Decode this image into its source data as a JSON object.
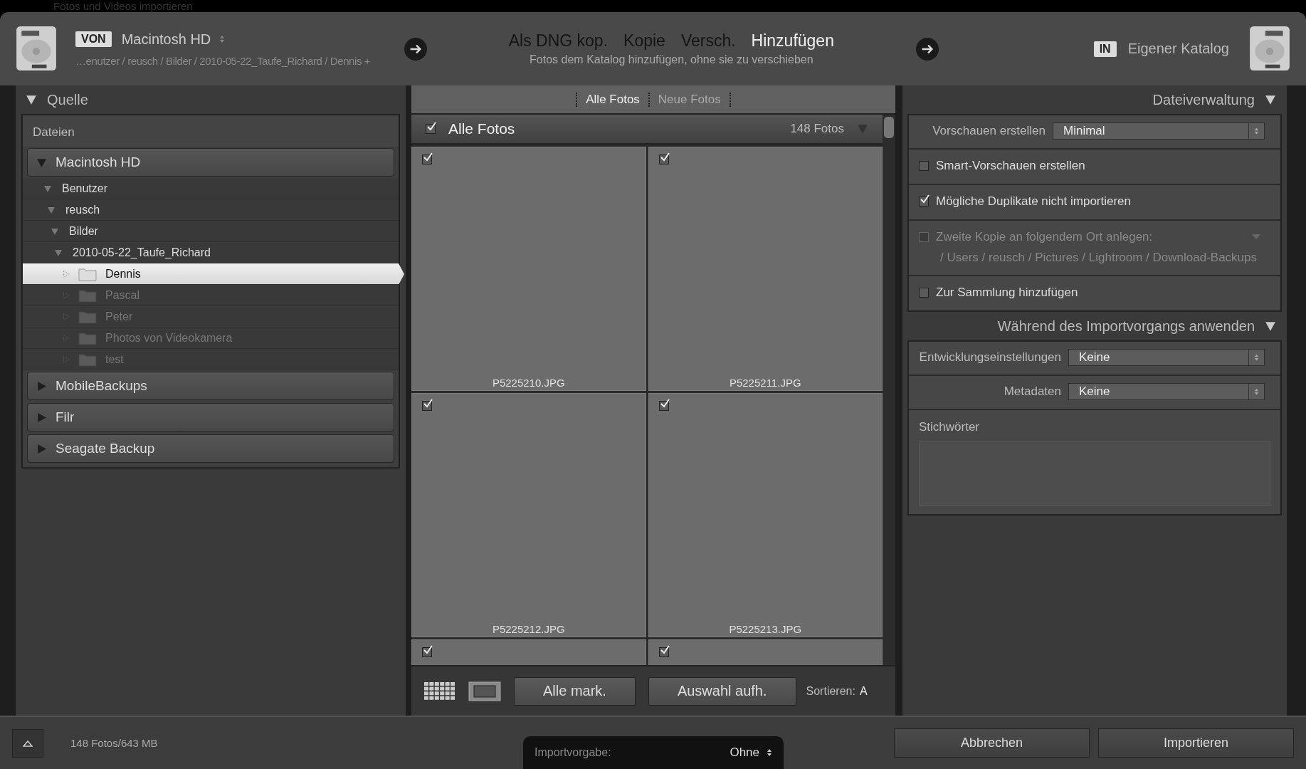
{
  "window": {
    "title": "Fotos und Videos importieren"
  },
  "header": {
    "source": {
      "badge": "VON",
      "name": "Macintosh HD",
      "path": "…enutzer / reusch / Bilder / 2010-05-22_Taufe_Richard / Dennis +"
    },
    "modes": [
      {
        "label": "Als DNG kop.",
        "selected": false
      },
      {
        "label": "Kopie",
        "selected": false
      },
      {
        "label": "Versch.",
        "selected": false
      },
      {
        "label": "Hinzufügen",
        "selected": true
      }
    ],
    "mode_description": "Fotos dem Katalog hinzufügen, ohne sie zu verschieben",
    "destination": {
      "badge": "IN",
      "name": "Eigener Katalog"
    }
  },
  "source_panel": {
    "title": "Quelle",
    "section": "Dateien",
    "tree": [
      {
        "kind": "volume",
        "name": "Macintosh HD",
        "expanded": true,
        "children": [
          {
            "kind": "dir",
            "name": "Benutzer",
            "expanded": true,
            "children": [
              {
                "kind": "dir",
                "name": "reusch",
                "expanded": true,
                "children": [
                  {
                    "kind": "dir",
                    "name": "Bilder",
                    "expanded": true,
                    "children": [
                      {
                        "kind": "dir",
                        "name": "2010-05-22_Taufe_Richard",
                        "expanded": true,
                        "children": [
                          {
                            "kind": "folder",
                            "name": "Dennis",
                            "selected": true
                          },
                          {
                            "kind": "folder",
                            "name": "Pascal",
                            "selected": false
                          },
                          {
                            "kind": "folder",
                            "name": "Peter",
                            "selected": false
                          },
                          {
                            "kind": "folder",
                            "name": "Photos von Videokamera",
                            "selected": false
                          },
                          {
                            "kind": "folder",
                            "name": "test",
                            "selected": false
                          }
                        ]
                      }
                    ]
                  }
                ]
              }
            ]
          }
        ]
      },
      {
        "kind": "volume",
        "name": "MobileBackups",
        "expanded": false
      },
      {
        "kind": "volume",
        "name": "Filr",
        "expanded": false
      },
      {
        "kind": "volume",
        "name": "Seagate Backup",
        "expanded": false
      }
    ]
  },
  "grid": {
    "tabs": [
      {
        "label": "Alle Fotos",
        "selected": true
      },
      {
        "label": "Neue Fotos",
        "selected": false
      }
    ],
    "header": {
      "checked": true,
      "title": "Alle Fotos",
      "count": "148 Fotos"
    },
    "photos": [
      {
        "filename": "P5225210.JPG",
        "checked": true
      },
      {
        "filename": "P5225211.JPG",
        "checked": true
      },
      {
        "filename": "P5225212.JPG",
        "checked": true
      },
      {
        "filename": "P5225213.JPG",
        "checked": true
      },
      {
        "checked": true
      },
      {
        "checked": true
      }
    ],
    "buttons": [
      "Alle mark.",
      "Auswahl aufh."
    ],
    "sort_label": "Sortieren:",
    "sort_value": "A"
  },
  "settings_panel": [
    {
      "title": "Dateiverwaltung",
      "rows": [
        {
          "kind": "select",
          "label": "Vorschauen erstellen",
          "value": "Minimal"
        },
        {
          "kind": "checkbox",
          "label": "Smart-Vorschauen erstellen",
          "checked": false,
          "disabled": false
        },
        {
          "kind": "checkbox",
          "label": "Mögliche Duplikate nicht importieren",
          "checked": true,
          "disabled": false
        },
        {
          "kind": "checkbox",
          "label": "Zweite Kopie an folgendem Ort anlegen:",
          "checked": false,
          "disabled": true,
          "detail": "/ Users / reusch / Pictures / Lightroom / Download-Backups"
        },
        {
          "kind": "checkbox",
          "label": "Zur Sammlung hinzufügen",
          "checked": false,
          "disabled": false
        }
      ]
    },
    {
      "title": "Während des Importvorgangs anwenden",
      "rows": [
        {
          "kind": "select",
          "label": "Entwicklungseinstellungen",
          "value": "Keine"
        },
        {
          "kind": "select",
          "label": "Metadaten",
          "value": "Keine"
        },
        {
          "kind": "textarea",
          "label": "Stichwörter"
        }
      ]
    }
  ],
  "footer": {
    "status": "148 Fotos/643 MB",
    "preset": {
      "label": "Importvorgabe:",
      "value": "Ohne"
    },
    "buttons": [
      "Abbrechen",
      "Importieren"
    ]
  }
}
